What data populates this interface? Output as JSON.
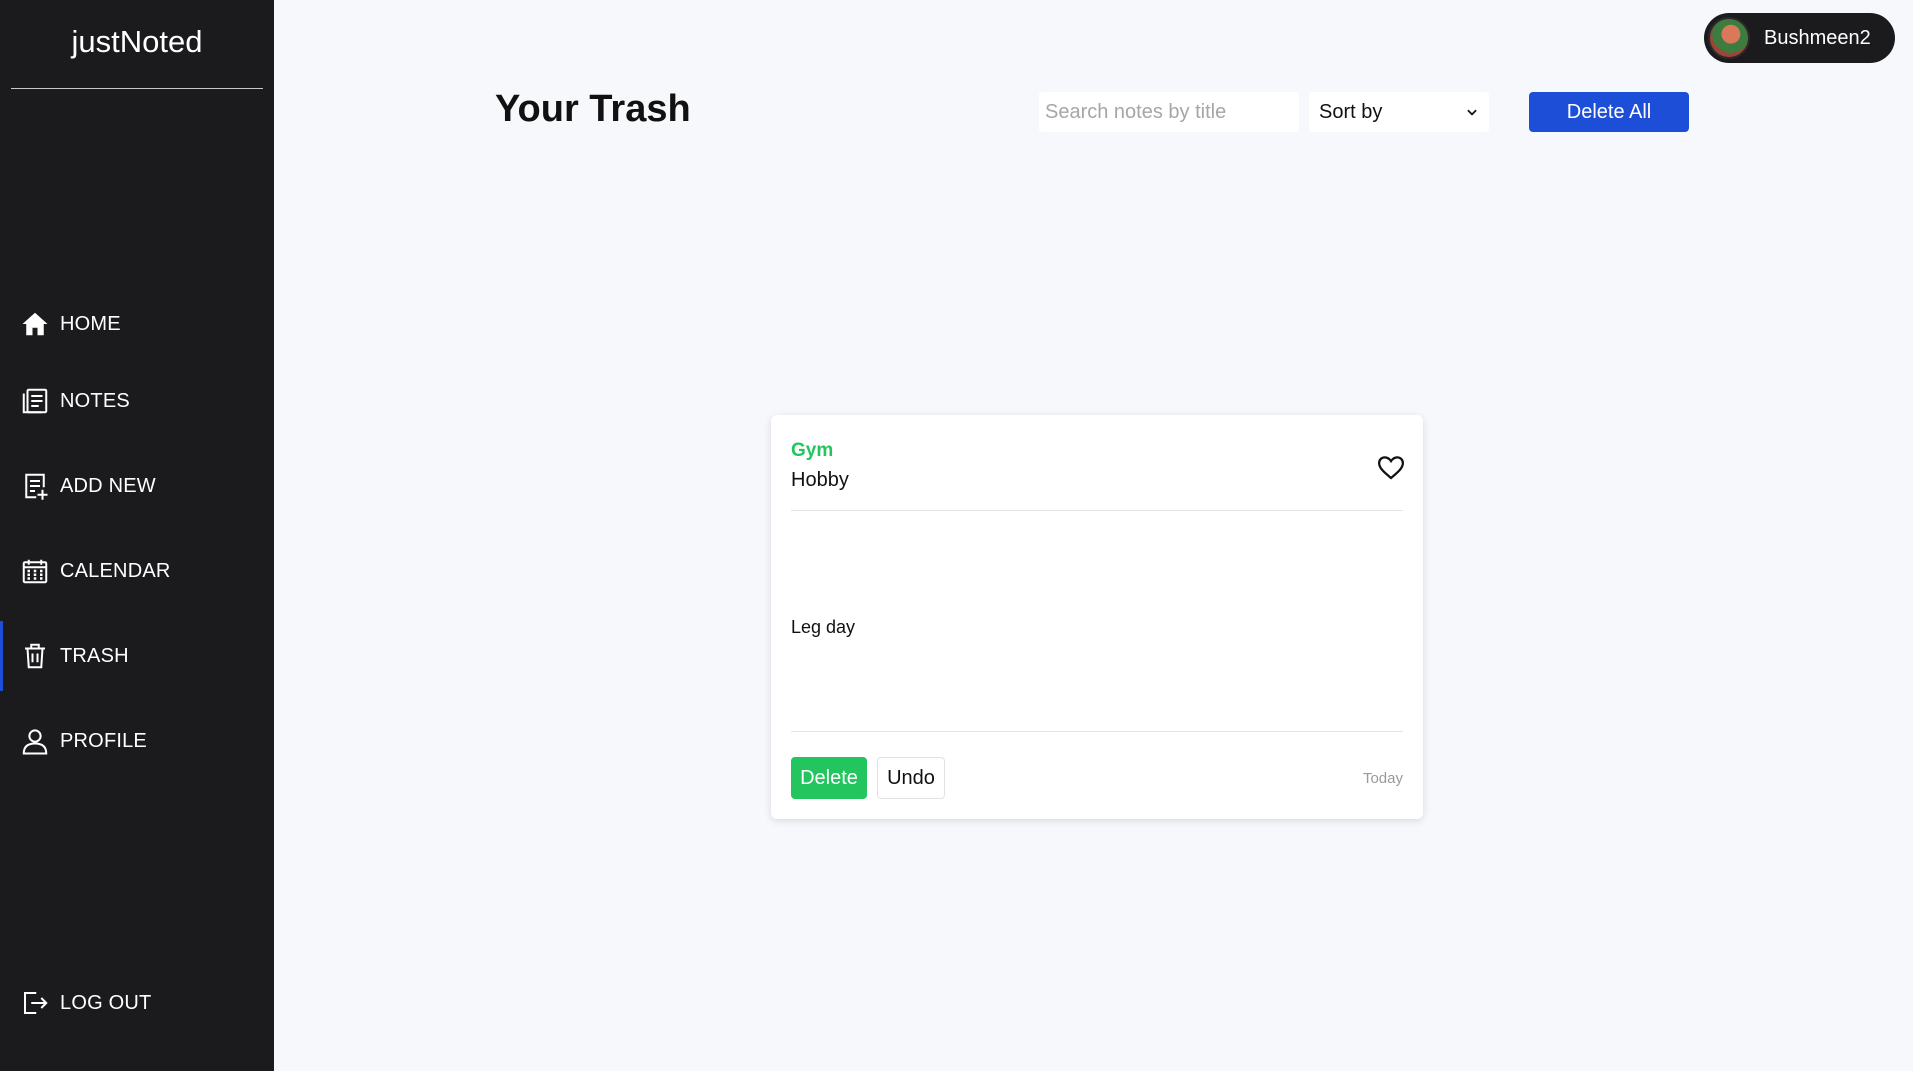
{
  "app": {
    "brand": "justNoted"
  },
  "sidebar": {
    "items": [
      {
        "label": "HOME",
        "icon": "home-icon"
      },
      {
        "label": "NOTES",
        "icon": "notes-icon"
      },
      {
        "label": "ADD NEW",
        "icon": "add-note-icon"
      },
      {
        "label": "CALENDAR",
        "icon": "calendar-icon"
      },
      {
        "label": "TRASH",
        "icon": "trash-icon",
        "active": true
      },
      {
        "label": "PROFILE",
        "icon": "user-icon"
      }
    ],
    "logout": {
      "label": "LOG OUT",
      "icon": "logout-icon"
    }
  },
  "user": {
    "name": "Bushmeen2"
  },
  "header": {
    "title": "Your Trash",
    "search_placeholder": "Search notes by title",
    "search_value": "",
    "sort_label": "Sort by",
    "delete_all_label": "Delete All"
  },
  "notes": [
    {
      "category": "Gym",
      "title": "Hobby",
      "body": "Leg day",
      "date": "Today",
      "delete_label": "Delete",
      "undo_label": "Undo",
      "favorite": false
    }
  ],
  "colors": {
    "sidebar_bg": "#1b1b1d",
    "page_bg": "#f7f8fc",
    "accent_blue": "#1d4ed8",
    "accent_green": "#22c55e"
  }
}
